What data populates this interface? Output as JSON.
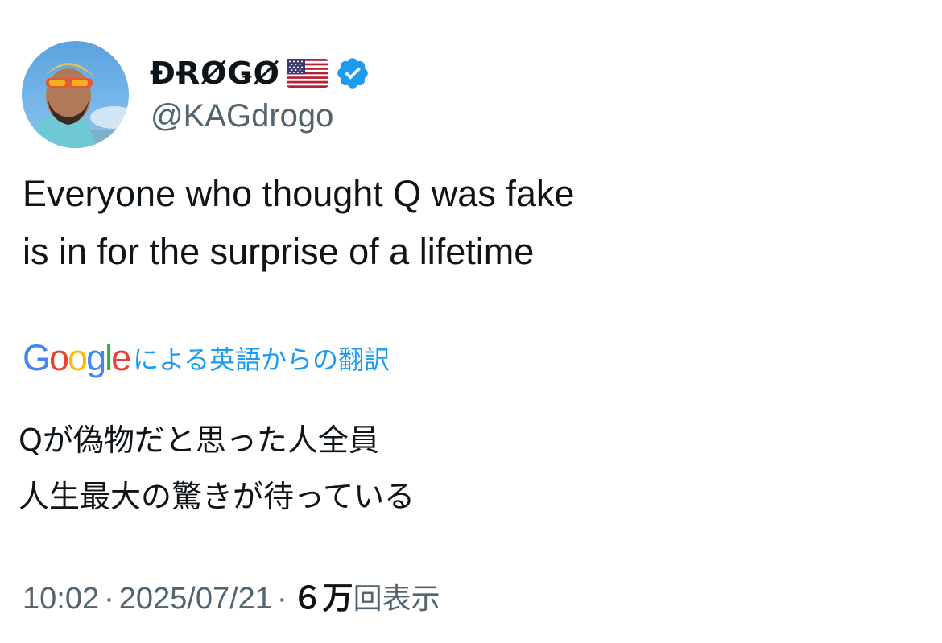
{
  "author": {
    "display_name": "ĐɌØǤØ",
    "flag": "us-flag-icon",
    "verified": true,
    "handle": "@KAGdrogo"
  },
  "tweet": {
    "lines": [
      "Everyone who thought Q was fake",
      "is in for the surprise of a lifetime"
    ]
  },
  "translation": {
    "provider_logo": "Google",
    "label": "による英語からの翻訳",
    "lines": [
      "Qが偽物だと思った人全員",
      "人生最大の驚きが待っている"
    ]
  },
  "meta": {
    "time": "10:02",
    "date": "2025/07/21",
    "separator": "·",
    "views_count": "６万",
    "views_label": "回表示"
  },
  "colors": {
    "text": "#0f1419",
    "secondary": "#536471",
    "accent": "#1d9bf0",
    "google_blue": "#4285F4",
    "google_red": "#EA4335",
    "google_yellow": "#FBBC05",
    "google_green": "#34A853"
  }
}
